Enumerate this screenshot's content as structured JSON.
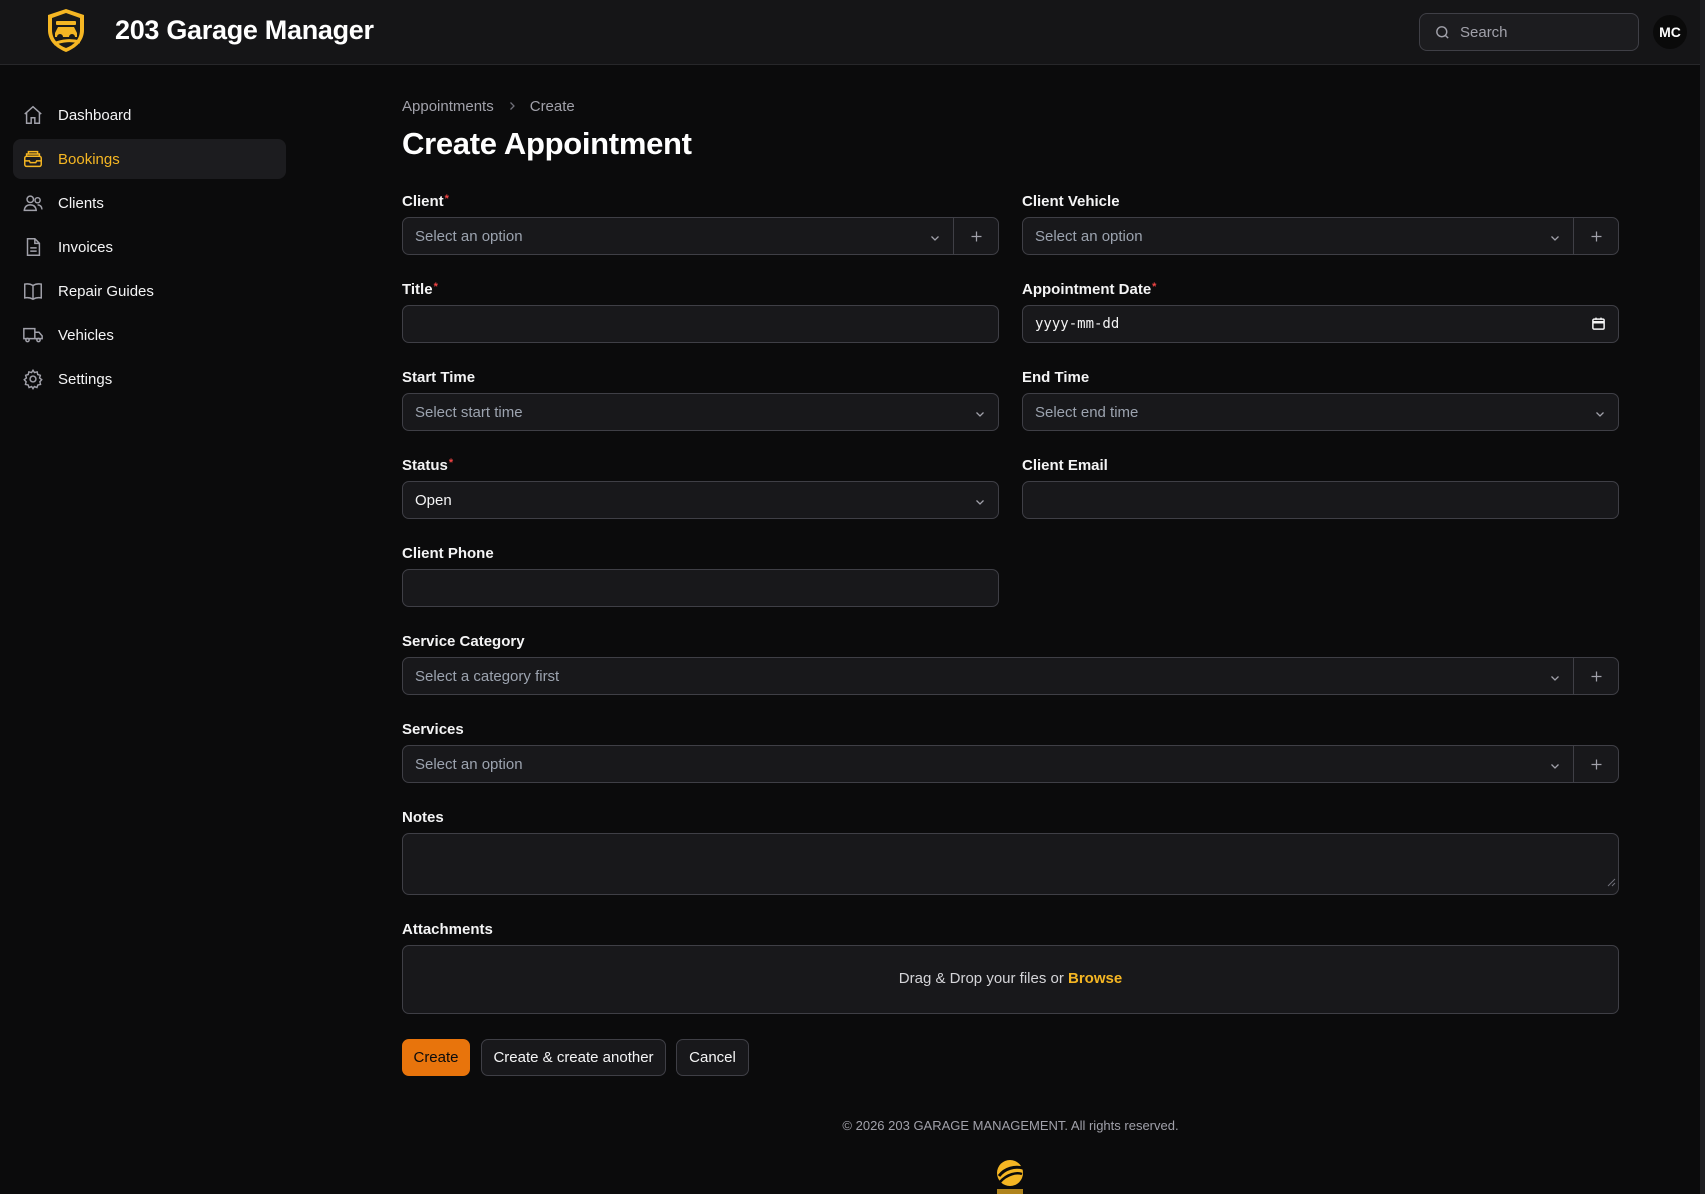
{
  "app": {
    "title": "203 Garage Manager",
    "avatar_initials": "MC",
    "search_placeholder": "Search",
    "accent_color": "#f5b623",
    "primary_button_color": "#e8740c"
  },
  "sidebar": {
    "items": [
      {
        "label": "Dashboard",
        "icon": "home-icon",
        "active": false
      },
      {
        "label": "Bookings",
        "icon": "inbox-stack-icon",
        "active": true
      },
      {
        "label": "Clients",
        "icon": "users-icon",
        "active": false
      },
      {
        "label": "Invoices",
        "icon": "document-icon",
        "active": false
      },
      {
        "label": "Repair Guides",
        "icon": "book-icon",
        "active": false
      },
      {
        "label": "Vehicles",
        "icon": "truck-icon",
        "active": false
      },
      {
        "label": "Settings",
        "icon": "gear-icon",
        "active": false
      }
    ]
  },
  "breadcrumb": {
    "parent": "Appointments",
    "current": "Create"
  },
  "page": {
    "title": "Create Appointment"
  },
  "form": {
    "client": {
      "label": "Client",
      "placeholder": "Select an option"
    },
    "client_vehicle": {
      "label": "Client Vehicle",
      "placeholder": "Select an option"
    },
    "title": {
      "label": "Title",
      "value": ""
    },
    "appointment_date": {
      "label": "Appointment Date",
      "placeholder": "yyyy-mm-dd"
    },
    "start_time": {
      "label": "Start Time",
      "placeholder": "Select start time"
    },
    "end_time": {
      "label": "End Time",
      "placeholder": "Select end time"
    },
    "status": {
      "label": "Status",
      "value": "Open"
    },
    "client_email": {
      "label": "Client Email",
      "value": ""
    },
    "client_phone": {
      "label": "Client Phone",
      "value": ""
    },
    "service_category": {
      "label": "Service Category",
      "placeholder": "Select a category first"
    },
    "services": {
      "label": "Services",
      "placeholder": "Select an option"
    },
    "notes": {
      "label": "Notes",
      "value": ""
    },
    "attachments": {
      "label": "Attachments",
      "drop_text": "Drag & Drop your files or",
      "browse_label": "Browse"
    },
    "required_marker": "*"
  },
  "actions": {
    "create": "Create",
    "create_another": "Create & create another",
    "cancel": "Cancel"
  },
  "footer": {
    "copyright": "© 2026 203 GARAGE MANAGEMENT. All rights reserved."
  }
}
